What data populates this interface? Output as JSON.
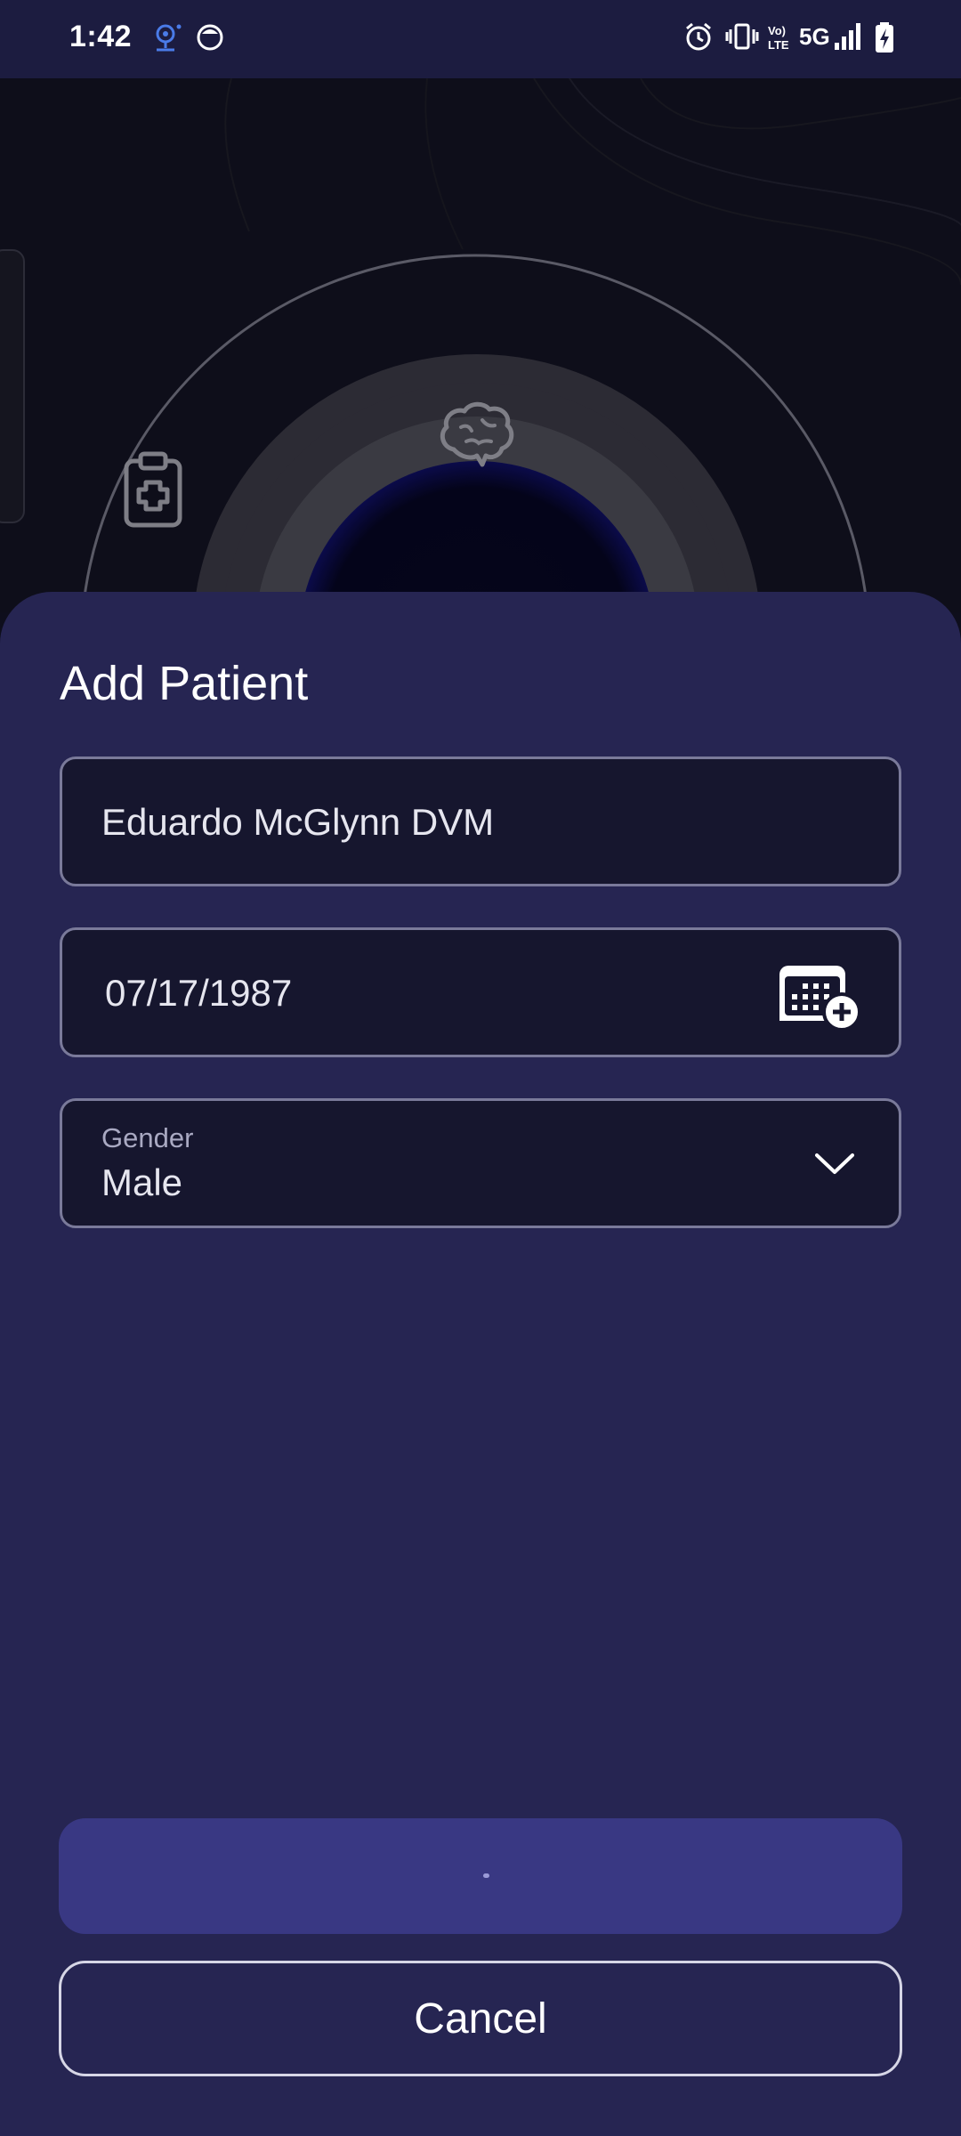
{
  "status_bar": {
    "time": "1:42",
    "network": "5G",
    "volte": "Vo LTE",
    "icons": [
      "location-tracker-icon",
      "face-app-icon",
      "alarm-icon",
      "vibrate-icon",
      "volte-icon",
      "signal-icon",
      "battery-charging-icon"
    ]
  },
  "background": {
    "icons": [
      "clipboard-medical-icon",
      "brain-icon"
    ]
  },
  "sheet": {
    "title": "Add Patient",
    "name_field": {
      "value": "Eduardo McGlynn DVM"
    },
    "dob_field": {
      "value": "07/17/1987",
      "action_icon": "calendar-add-icon"
    },
    "gender_field": {
      "label": "Gender",
      "value": "Male",
      "action_icon": "chevron-down-icon"
    },
    "primary_button": {
      "label": "",
      "state": "loading"
    },
    "cancel_button": {
      "label": "Cancel"
    }
  },
  "colors": {
    "status_bar": "#1c1c40",
    "sheet": "#262552",
    "field_bg": "#16162e",
    "field_border": "#7a7a9a",
    "primary_button": "#393883",
    "background": "#0e0e1c"
  }
}
